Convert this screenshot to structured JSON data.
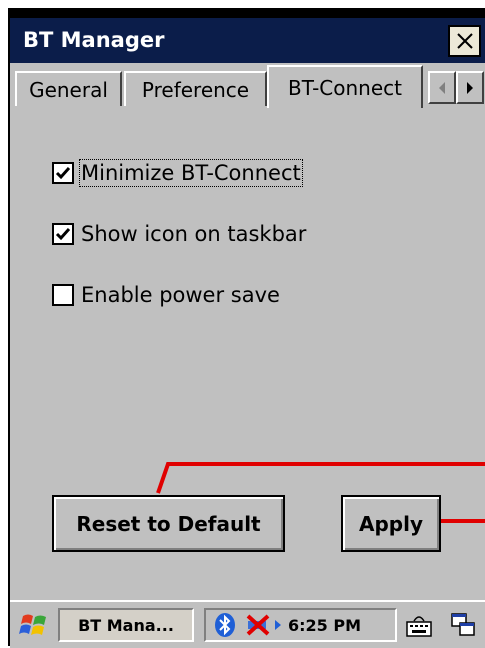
{
  "window": {
    "title": "BT Manager",
    "close_label": "✕"
  },
  "tabs": [
    {
      "label": "General"
    },
    {
      "label": "Preference"
    },
    {
      "label": "BT-Connect"
    }
  ],
  "tab_scroll": {
    "left_icon": "arrow-left",
    "right_icon": "arrow-right"
  },
  "options": [
    {
      "label": "Minimize BT-Connect",
      "checked": true
    },
    {
      "label": "Show icon on taskbar",
      "checked": true
    },
    {
      "label": "Enable power save",
      "checked": false
    }
  ],
  "buttons": {
    "reset": "Reset to Default",
    "apply": "Apply"
  },
  "taskbar": {
    "task_label": "BT Mana...",
    "clock": "6:25 PM",
    "icons": [
      "start-flag-icon",
      "bluetooth-icon",
      "network-disconnected-icon",
      "keyboard-icon",
      "switch-windows-icon"
    ]
  },
  "colors": {
    "titlebar": "#0b1d4a",
    "face": "#c0c0c0",
    "annotation": "#e00000"
  }
}
